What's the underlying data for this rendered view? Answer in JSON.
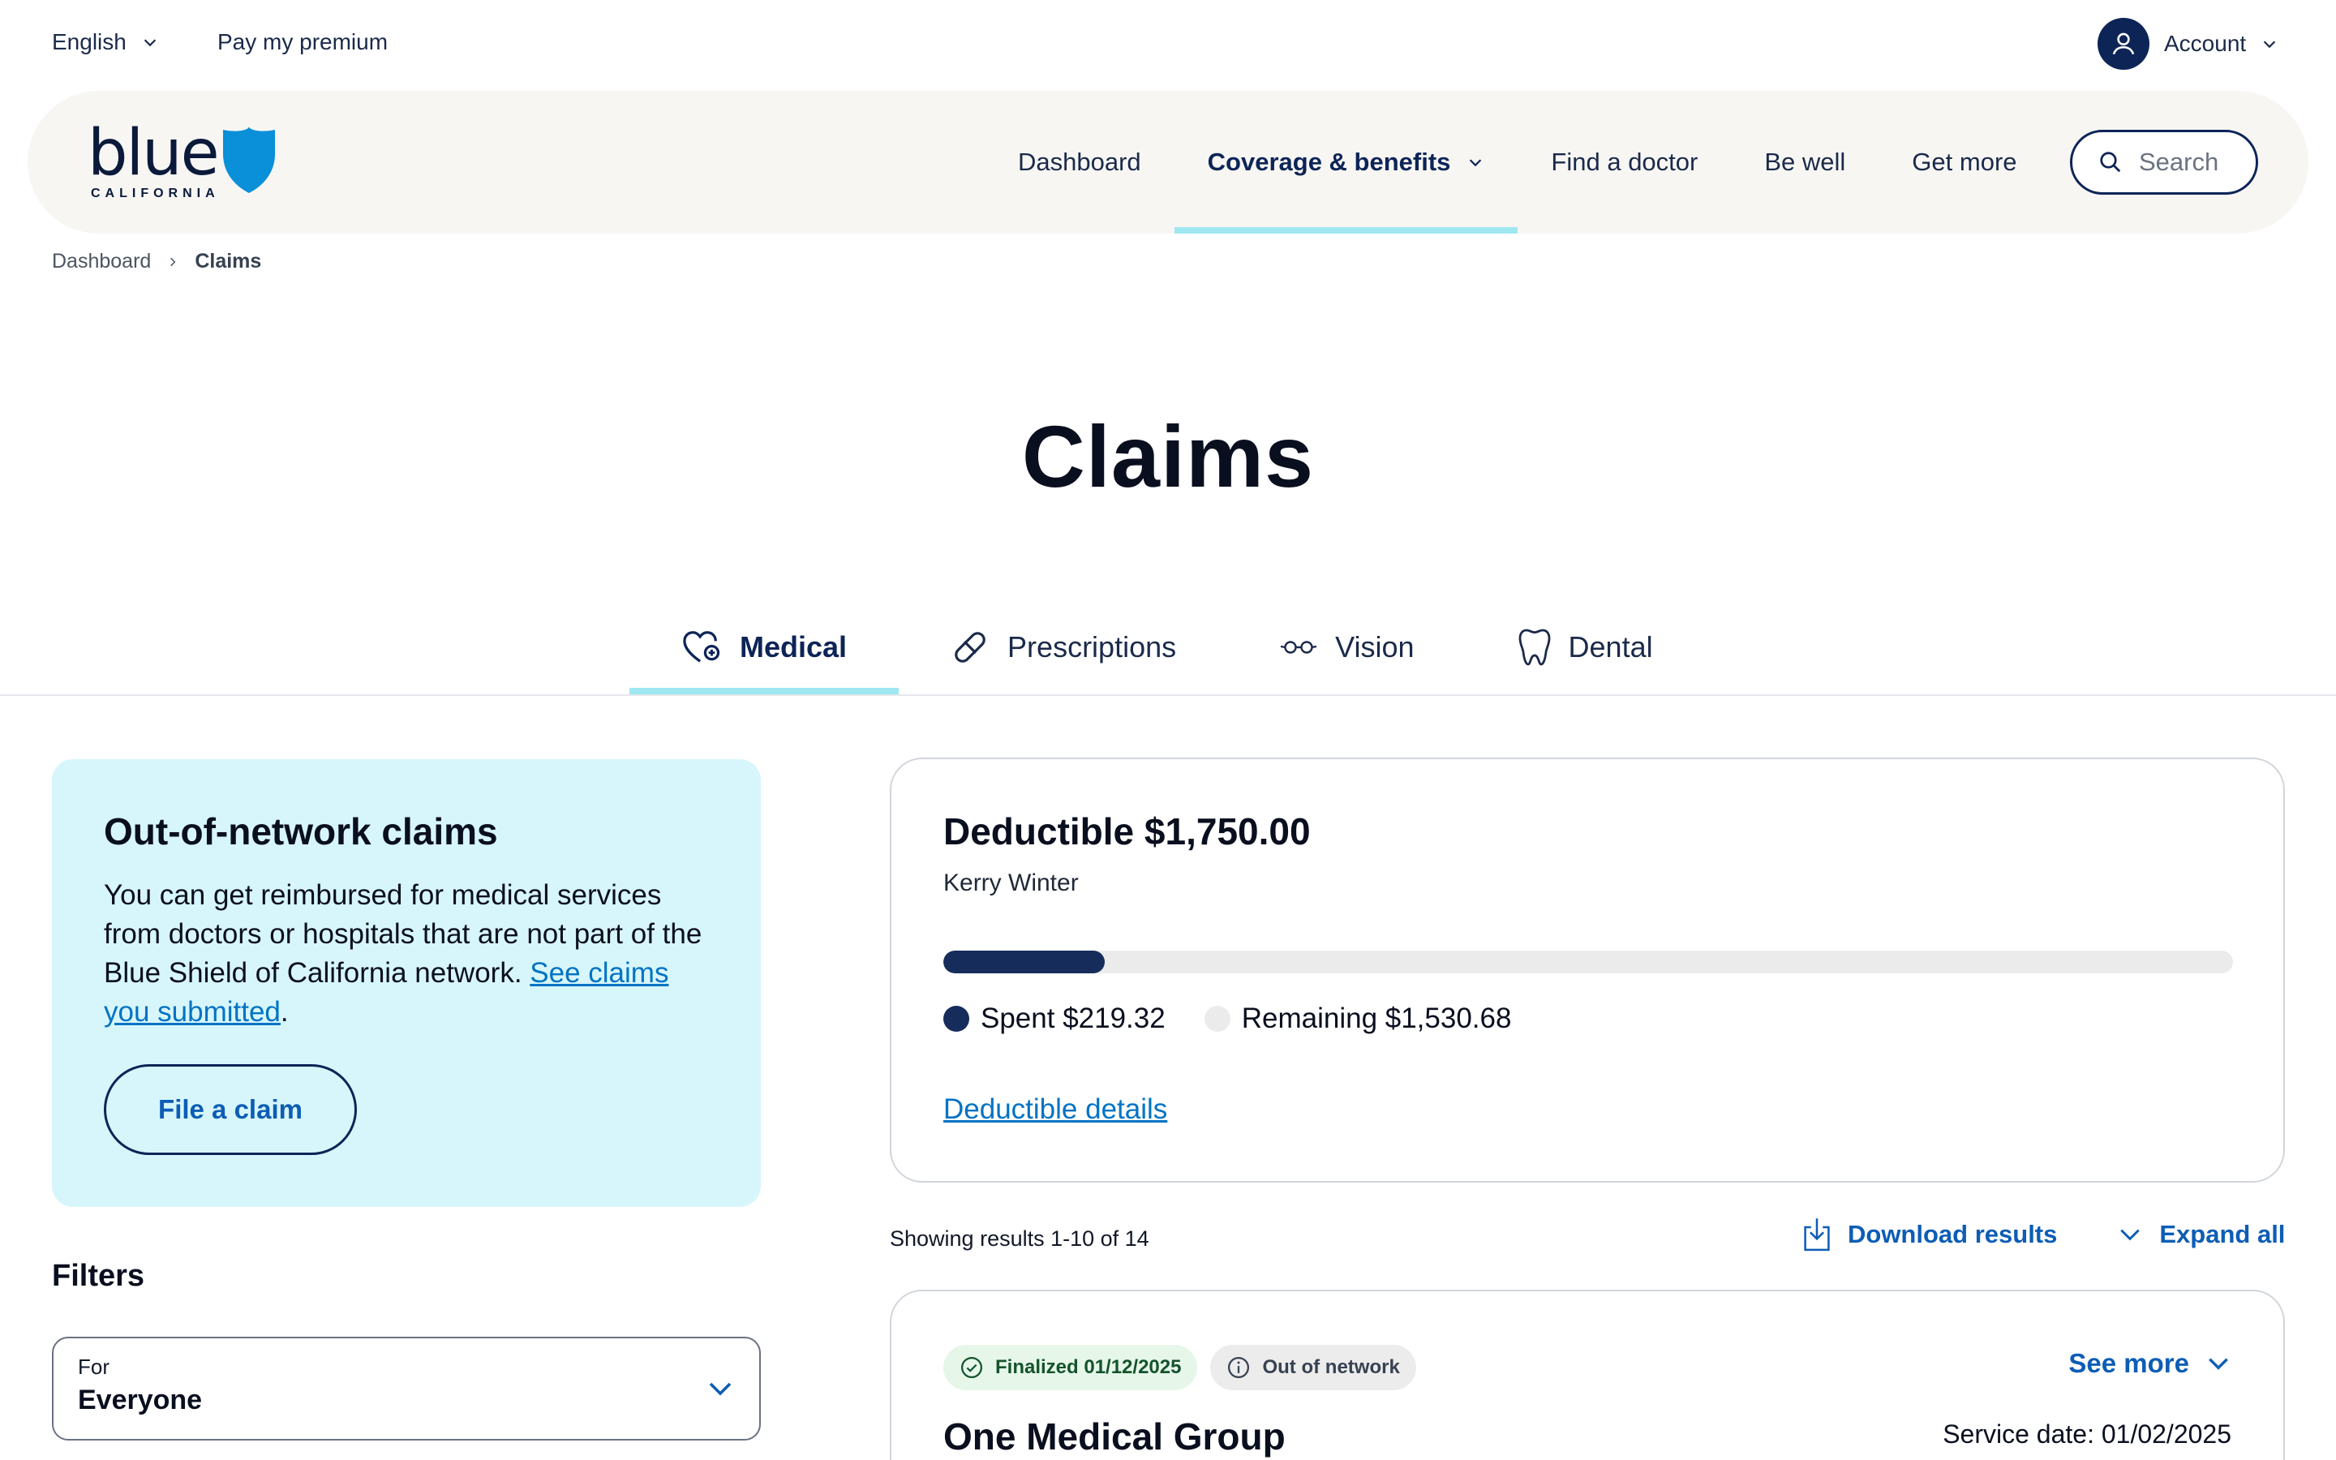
{
  "utility": {
    "language": "English",
    "pay_premium": "Pay my premium",
    "account": "Account"
  },
  "brand": {
    "logo_word": "blue",
    "logo_sub": "CALIFORNIA",
    "logo_color": "#0b1a3a",
    "shield_color": "#0a8fd9"
  },
  "nav": {
    "items": [
      {
        "label": "Dashboard"
      },
      {
        "label": "Coverage & benefits"
      },
      {
        "label": "Find a doctor"
      },
      {
        "label": "Be well"
      },
      {
        "label": "Get more"
      }
    ],
    "search_label": "Search",
    "accent": "#9fe8f2"
  },
  "breadcrumb": {
    "home": "Dashboard",
    "current": "Claims"
  },
  "page": {
    "title": "Claims"
  },
  "tabs": [
    {
      "label": "Medical",
      "icon": "heart-plus-icon"
    },
    {
      "label": "Prescriptions",
      "icon": "pill-icon"
    },
    {
      "label": "Vision",
      "icon": "glasses-icon"
    },
    {
      "label": "Dental",
      "icon": "tooth-icon"
    }
  ],
  "oon": {
    "title": "Out-of-network claims",
    "body": "You can get reimbursed for medical services from doctors or hospitals that are not part of the Blue Shield of California network. ",
    "link": "See claims you submitted",
    "period": ".",
    "button": "File a claim"
  },
  "filters": {
    "title": "Filters",
    "for_label": "For",
    "for_value": "Everyone"
  },
  "deductible": {
    "title": "Deductible $1,750.00",
    "member": "Kerry Winter",
    "spent_label": "Spent $219.32",
    "remaining_label": "Remaining $1,530.68",
    "spent_fraction": 0.1253,
    "spent_color": "#162c5b",
    "remaining_color": "#ebebeb",
    "link": "Deductible details"
  },
  "results": {
    "count": "Showing results 1-10 of 14",
    "download": "Download results",
    "expand": "Expand all"
  },
  "claim": {
    "status": "Finalized 01/12/2025",
    "network": "Out of network",
    "see_more": "See more",
    "provider": "One Medical Group",
    "service_date": "Service date: 01/02/2025"
  }
}
